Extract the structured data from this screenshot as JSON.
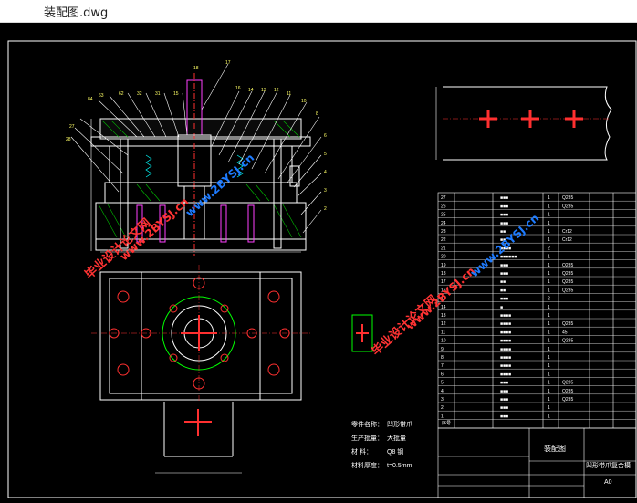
{
  "window": {
    "title": "装配图.dwg"
  },
  "drawing": {
    "background": "#000000",
    "line_color": "#ffffff",
    "accent_red": "#ff3030",
    "accent_green": "#00ff00",
    "accent_cyan": "#00ffff",
    "accent_magenta": "#ff40ff"
  },
  "watermarks": [
    "毕业设计论文网",
    "www.2BYSJ.cn",
    "毕业设计论文网",
    "www.2BYSJ.cn",
    "毕业设计论文网",
    "www.2BYSJ.cn"
  ],
  "tech_notes": {
    "line1": "零件名称：",
    "line1_value": "凹形带爪",
    "line2": "生产批量：",
    "line2_value": "大批量",
    "line3": "材 料：",
    "line3_value": "Q8 钢",
    "line4": "材料厚度：",
    "line4_value": "t=0.5mm"
  },
  "bom": {
    "rows": [
      {
        "no": "27",
        "name": "■■■",
        "qty": "1",
        "mat": "Q235"
      },
      {
        "no": "26",
        "name": "■■■",
        "qty": "1",
        "mat": "Q235"
      },
      {
        "no": "25",
        "name": "■■■",
        "qty": "1",
        "mat": ""
      },
      {
        "no": "24",
        "name": "■■■",
        "qty": "1",
        "mat": ""
      },
      {
        "no": "23",
        "name": "■■",
        "qty": "1",
        "mat": "Cr12"
      },
      {
        "no": "22",
        "name": "■■",
        "qty": "1",
        "mat": "Cr12"
      },
      {
        "no": "21",
        "name": "■■■■",
        "qty": "2",
        "mat": ""
      },
      {
        "no": "20",
        "name": "■■■■■■",
        "qty": "1",
        "mat": ""
      },
      {
        "no": "19",
        "name": "■■■",
        "qty": "1",
        "mat": "Q235"
      },
      {
        "no": "18",
        "name": "■■■",
        "qty": "1",
        "mat": "Q235"
      },
      {
        "no": "17",
        "name": "■■",
        "qty": "1",
        "mat": "Q235"
      },
      {
        "no": "16",
        "name": "■■",
        "qty": "1",
        "mat": "Q235"
      },
      {
        "no": "15",
        "name": "■■■",
        "qty": "2",
        "mat": ""
      },
      {
        "no": "14",
        "name": "■",
        "qty": "1",
        "mat": ""
      },
      {
        "no": "13",
        "name": "■■■■",
        "qty": "1",
        "mat": ""
      },
      {
        "no": "12",
        "name": "■■■■",
        "qty": "1",
        "mat": "Q235"
      },
      {
        "no": "11",
        "name": "■■■■",
        "qty": "1",
        "mat": "45"
      },
      {
        "no": "10",
        "name": "■■■■",
        "qty": "1",
        "mat": "Q235"
      },
      {
        "no": "9",
        "name": "■■■■",
        "qty": "1",
        "mat": ""
      },
      {
        "no": "8",
        "name": "■■■■",
        "qty": "1",
        "mat": ""
      },
      {
        "no": "7",
        "name": "■■■■",
        "qty": "1",
        "mat": ""
      },
      {
        "no": "6",
        "name": "■■■■",
        "qty": "1",
        "mat": ""
      },
      {
        "no": "5",
        "name": "■■■",
        "qty": "1",
        "mat": "Q235"
      },
      {
        "no": "4",
        "name": "■■■",
        "qty": "1",
        "mat": "Q235"
      },
      {
        "no": "3",
        "name": "■■■",
        "qty": "1",
        "mat": "Q235"
      },
      {
        "no": "2",
        "name": "■■■",
        "qty": "1",
        "mat": ""
      },
      {
        "no": "1",
        "name": "■■■",
        "qty": "1",
        "mat": ""
      }
    ],
    "header_no": "序号"
  },
  "title_block": {
    "drawing_name": "装配图",
    "part_name": "凹形带爪复合模",
    "sheet_size": "A0"
  }
}
